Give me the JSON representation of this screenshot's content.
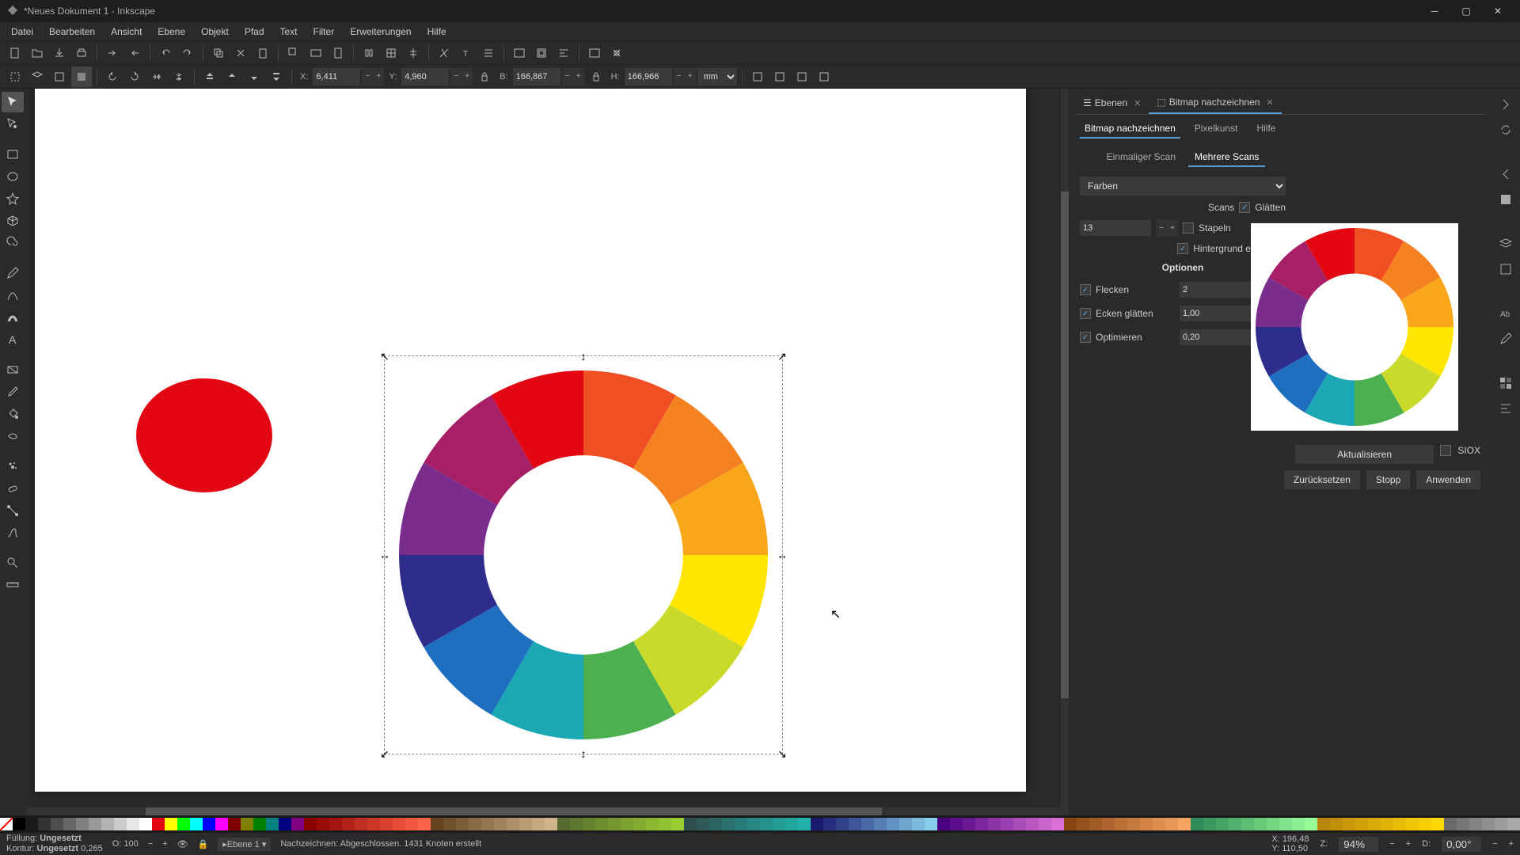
{
  "window": {
    "title": "*Neues Dokument 1 - Inkscape"
  },
  "menu": [
    "Datei",
    "Bearbeiten",
    "Ansicht",
    "Ebene",
    "Objekt",
    "Pfad",
    "Text",
    "Filter",
    "Erweiterungen",
    "Hilfe"
  ],
  "toolbar2": {
    "x_label": "X:",
    "x_val": "6,411",
    "y_label": "Y:",
    "y_val": "4,960",
    "w_label": "B:",
    "w_val": "166,867",
    "h_label": "H:",
    "h_val": "166,966",
    "unit": "mm"
  },
  "panel": {
    "tabs": {
      "layers": "Ebenen",
      "trace": "Bitmap nachzeichnen"
    },
    "inner": {
      "trace": "Bitmap nachzeichnen",
      "pixel": "Pixelkunst",
      "help": "Hilfe"
    },
    "scan": {
      "single": "Einmaliger Scan",
      "multi": "Mehrere Scans"
    },
    "mode": "Farben",
    "scans_label": "Scans",
    "scans_val": "13",
    "glaetten": "Glätten",
    "stapeln": "Stapeln",
    "bg": "Hintergrund entfernen",
    "options": "Optionen",
    "flecken": "Flecken",
    "flecken_val": "2",
    "ecken": "Ecken glätten",
    "ecken_val": "1,00",
    "opt": "Optimieren",
    "opt_val": "0,20",
    "update": "Aktualisieren",
    "siox": "SIOX",
    "reset": "Zurücksetzen",
    "stop": "Stopp",
    "apply": "Anwenden"
  },
  "status": {
    "fill": "Füllung:",
    "fill_val": "Ungesetzt",
    "stroke": "Kontur:",
    "stroke_val": "Ungesetzt",
    "stroke_w": "0,265",
    "opacity": "O: 100",
    "layer": "▸Ebene 1 ▾",
    "msg": "Nachzeichnen: Abgeschlossen. 1431 Knoten erstellt",
    "coords_x": "X:",
    "cx": "196,48",
    "coords_y": "Y:",
    "cy": "110,50",
    "zoom_label": "Z:",
    "zoom": "94%",
    "rotate_label": "D:",
    "rotate": "0,00°"
  },
  "icons": {
    "tools": [
      "selector",
      "node",
      "rect",
      "ellipse",
      "star",
      "threed",
      "spiral",
      "pencil",
      "bezier",
      "calligraphy",
      "text",
      "gradient",
      "dropper",
      "bucket",
      "connector",
      "eraser",
      "paint",
      "zoom",
      "measure"
    ]
  }
}
